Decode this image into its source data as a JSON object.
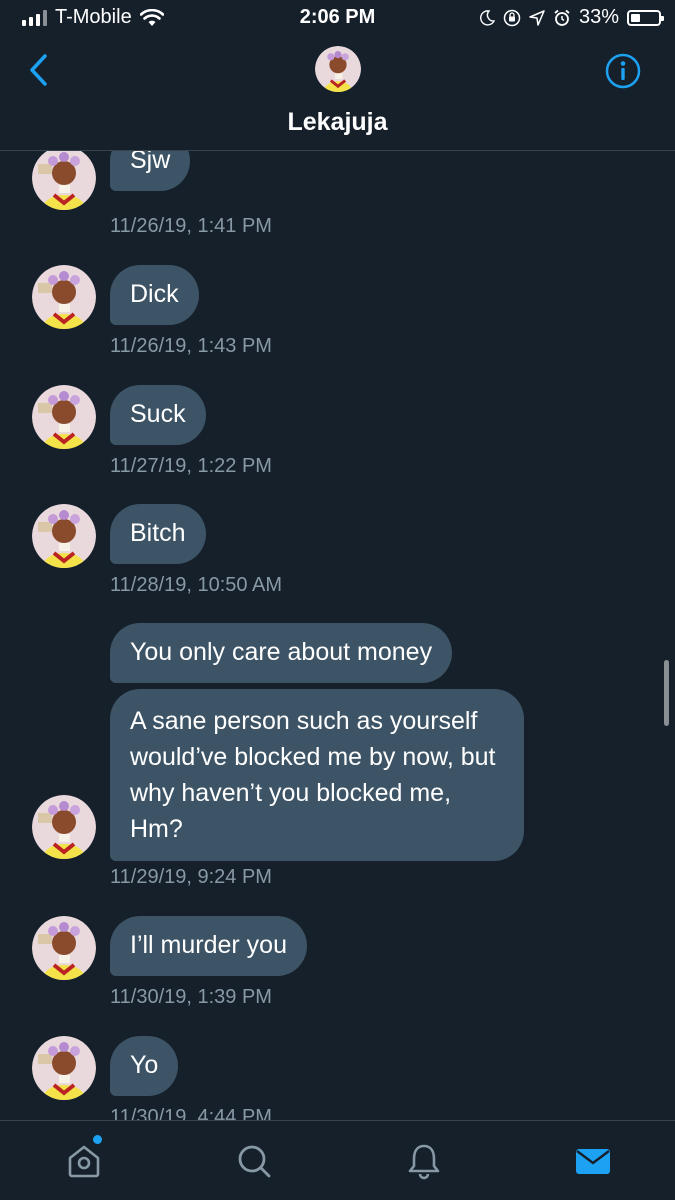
{
  "status_bar": {
    "carrier": "T-Mobile",
    "time": "2:06 PM",
    "battery": "33%",
    "battery_level": 0.33
  },
  "header": {
    "contact_name": "Lekajuja",
    "back_icon": "chevron-left-icon",
    "info_icon": "info-icon"
  },
  "messages": [
    {
      "text": "Sjw",
      "timestamp": "11/26/19, 1:41 PM"
    },
    {
      "text": "Dick",
      "timestamp": "11/26/19, 1:43 PM"
    },
    {
      "text": "Suck",
      "timestamp": "11/27/19, 1:22 PM"
    },
    {
      "text": "Bitch",
      "timestamp": "11/28/19, 10:50 AM"
    },
    {
      "text": "You only care about money",
      "text2": "A sane person such as yourself would’ve blocked me by now, but why haven’t you blocked me, Hm?",
      "timestamp": "11/29/19, 9:24 PM"
    },
    {
      "text": "I’ll murder you",
      "timestamp": "11/30/19, 1:39 PM"
    },
    {
      "text": "Yo",
      "timestamp": "11/30/19, 4:44 PM"
    }
  ],
  "tabbar": {
    "items": [
      "home-icon",
      "search-icon",
      "bell-icon",
      "mail-icon"
    ],
    "active": "mail-icon",
    "accent": "#1da1f2"
  },
  "colors": {
    "background": "#15202b",
    "bubble": "#3d5466",
    "timestamp": "#8899a6"
  }
}
